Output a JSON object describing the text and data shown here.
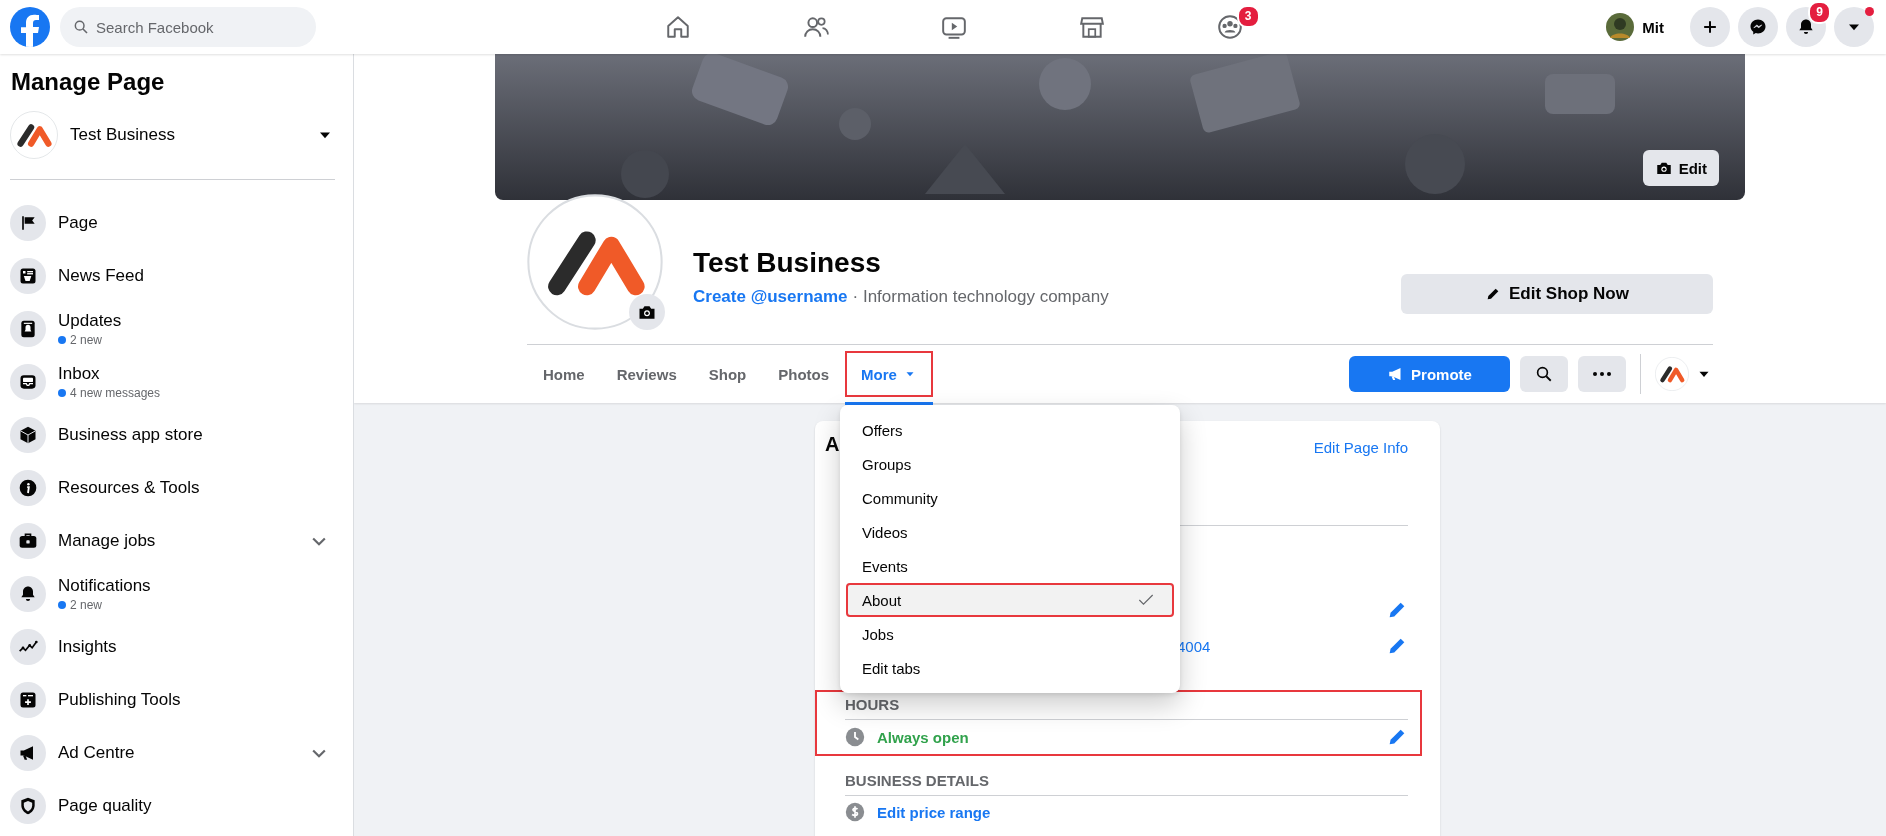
{
  "topbar": {
    "search": {
      "placeholder": "Search Facebook"
    },
    "nav": [
      {
        "kind": "home"
      },
      {
        "kind": "friends"
      },
      {
        "kind": "watch"
      },
      {
        "kind": "marketplace"
      },
      {
        "kind": "groups",
        "badge": "3"
      }
    ],
    "account": {
      "name": "Mit"
    },
    "actions": [
      {
        "kind": "plus"
      },
      {
        "kind": "messenger"
      },
      {
        "kind": "bell",
        "badge": "9"
      },
      {
        "kind": "caret",
        "dot": true
      }
    ]
  },
  "sidebar": {
    "title": "Manage Page",
    "page": {
      "name": "Test Business"
    },
    "items": [
      {
        "kind": "flag",
        "label": "Page",
        "expandable": false
      },
      {
        "kind": "feed",
        "label": "News Feed",
        "expandable": false
      },
      {
        "kind": "updates",
        "label": "Updates",
        "sub": "2 new",
        "expandable": false
      },
      {
        "kind": "inbox",
        "label": "Inbox",
        "sub": "4 new messages",
        "expandable": false
      },
      {
        "kind": "cube",
        "label": "Business app store",
        "expandable": false
      },
      {
        "kind": "info",
        "label": "Resources & Tools",
        "expandable": false
      },
      {
        "kind": "briefcase",
        "label": "Manage jobs",
        "expandable": true
      },
      {
        "kind": "bell",
        "label": "Notifications",
        "sub": "2 new",
        "expandable": false
      },
      {
        "kind": "chart",
        "label": "Insights",
        "expandable": false
      },
      {
        "kind": "publish",
        "label": "Publishing Tools",
        "expandable": false
      },
      {
        "kind": "megaphone",
        "label": "Ad Centre",
        "expandable": true
      },
      {
        "kind": "shield",
        "label": "Page quality",
        "expandable": false
      }
    ]
  },
  "header": {
    "cover_edit": "Edit",
    "name": "Test Business",
    "username_link": "Create @username",
    "category": "· Information technology company",
    "action": "Edit Shop Now",
    "tabs": [
      {
        "label": "Home",
        "selected": false,
        "annotated": false
      },
      {
        "label": "Reviews",
        "selected": false,
        "annotated": false
      },
      {
        "label": "Shop",
        "selected": false,
        "annotated": false
      },
      {
        "label": "Photos",
        "selected": false,
        "annotated": false
      },
      {
        "label": "More",
        "selected": true,
        "annotated": true
      }
    ],
    "promote": "Promote"
  },
  "menu": {
    "items": [
      {
        "label": "Offers",
        "selected": false,
        "annotated": false
      },
      {
        "label": "Groups",
        "selected": false,
        "annotated": false
      },
      {
        "label": "Community",
        "selected": false,
        "annotated": false
      },
      {
        "label": "Videos",
        "selected": false,
        "annotated": false
      },
      {
        "label": "Events",
        "selected": false,
        "annotated": false
      },
      {
        "label": "About",
        "selected": true,
        "annotated": true
      },
      {
        "label": "Jobs",
        "selected": false,
        "annotated": false
      },
      {
        "label": "Edit tabs",
        "selected": false,
        "annotated": false
      }
    ]
  },
  "about": {
    "title": "A",
    "edit_link": "Edit Page Info",
    "contact_rows": [
      {
        "editable": true
      },
      {
        "value": "4004",
        "editable": true
      }
    ],
    "sections": [
      {
        "heading": "HOURS",
        "annotated": true,
        "rows": [
          {
            "kind": "status",
            "text": "Always open"
          }
        ]
      },
      {
        "heading": "BUSINESS DETAILS",
        "annotated": false,
        "rows": [
          {
            "kind": "link",
            "text": "Edit price range"
          }
        ]
      }
    ]
  }
}
